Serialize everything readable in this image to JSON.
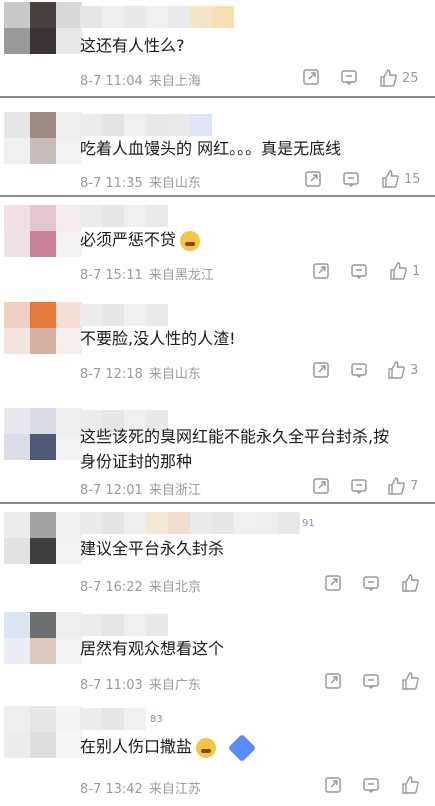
{
  "comments": [
    {
      "text": "这还有人性么?",
      "time": "8-7 11:04",
      "location": "来自上海",
      "likes": "25",
      "badge": ""
    },
    {
      "text": "吃着人血馒头的 网红。。。真是无底线",
      "time": "8-7 11:35",
      "location": "来自山东",
      "likes": "15",
      "badge": ""
    },
    {
      "text": "必须严惩不贷",
      "time": "8-7 15:11",
      "location": "来自黑龙江",
      "likes": "1",
      "badge": ""
    },
    {
      "text": "不要脸,没人性的人渣!",
      "time": "8-7 12:18",
      "location": "来自山东",
      "likes": "3",
      "badge": ""
    },
    {
      "text": "这些该死的臭网红能不能永久全平台封杀,按",
      "text2": "身份证封的那种",
      "time": "8-7 12:01",
      "location": "来自浙江",
      "likes": "7",
      "badge": ""
    },
    {
      "text": "建议全平台永久封杀",
      "time": "8-7 16:22",
      "location": "来自北京",
      "likes": "",
      "badge": "91"
    },
    {
      "text": "居然有观众想看这个",
      "time": "8-7 11:03",
      "location": "来自广东",
      "likes": "",
      "badge": ""
    },
    {
      "text": "在别人伤口撒盐",
      "time": "8-7 13:42",
      "location": "来自江苏",
      "likes": "",
      "badge": "83"
    }
  ],
  "icons": {
    "share": "share-icon",
    "comment": "comment-icon",
    "like": "thumb-up-icon"
  },
  "colors": {
    "meta": "#9a9a9a",
    "divider": "#8a8a8a"
  }
}
